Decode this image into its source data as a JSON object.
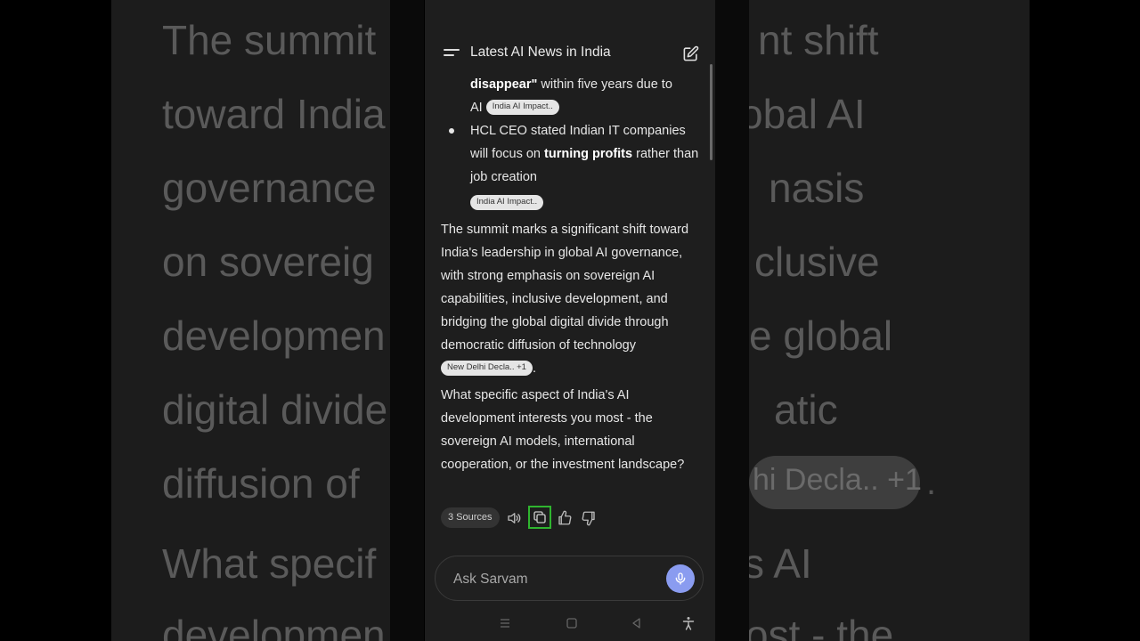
{
  "background_text": {
    "left_lines": [
      "The summit",
      "toward India",
      "governance",
      "on sovereig",
      "developmen",
      "digital divide",
      "diffusion of",
      "What specif",
      "developmen"
    ],
    "right_lines": [
      "nt shift",
      "obal AI",
      "nasis",
      "clusive",
      "e global",
      "atic",
      "",
      "s AI",
      "ost - the"
    ],
    "right_chip": "hi Decla.. +1",
    "right_dot": "."
  },
  "header": {
    "title": "Latest AI News in India"
  },
  "content": {
    "line1_bold": "disappear\"",
    "line1_rest": " within five years due to",
    "line2": "AI",
    "chip1": "India AI Impact..",
    "bullet_text_1": "HCL CEO stated Indian IT companies will focus on ",
    "bullet_bold": "turning profits",
    "bullet_text_2": " rather than job creation",
    "chip2": "India AI Impact..",
    "paragraph1": "The summit marks a significant shift toward India's leadership in global AI governance, with strong emphasis on sovereign AI capabilities, inclusive development, and bridging the global digital divide through democratic diffusion of technology",
    "chip3": "New Delhi Decla.. +1",
    "paragraph1_end": ".",
    "paragraph2": "What specific aspect of India's AI development interests you most - the sovereign AI models, international cooperation, or the investment landscape?"
  },
  "actions": {
    "sources_label": "3 Sources",
    "icons": [
      "speaker-icon",
      "copy-icon",
      "thumbs-up-icon",
      "thumbs-down-icon"
    ],
    "highlight_color": "#2fb52f"
  },
  "input": {
    "placeholder": "Ask Sarvam"
  },
  "colors": {
    "mic_button": "#8a9cf0",
    "phone_bg": "#1e1e1e"
  }
}
